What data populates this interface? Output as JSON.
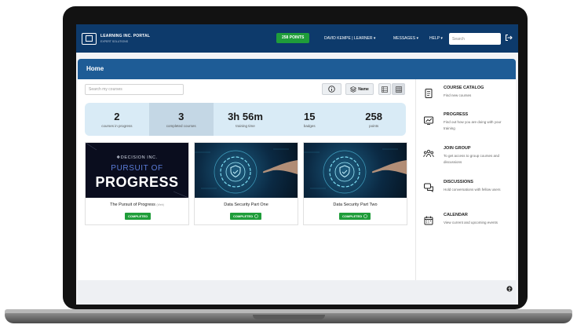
{
  "header": {
    "logo_title": "LEARNING INC. PORTAL",
    "logo_subtitle": "EXPERT SOLUTIONS",
    "points_badge": "258 POINTS",
    "user_menu": "DAVID KEMPE | LEARNER ▾",
    "messages_menu": "MESSAGES ▾",
    "help_menu": "HELP ▾",
    "search_placeholder": "Search"
  },
  "page": {
    "title": "Home"
  },
  "toolbar": {
    "course_search_placeholder": "Search my courses",
    "sort_label": "Name"
  },
  "stats": [
    {
      "value": "2",
      "label": "courses in progress"
    },
    {
      "value": "3",
      "label": "completed courses"
    },
    {
      "value": "3h 56m",
      "label": "training time"
    },
    {
      "value": "15",
      "label": "badges"
    },
    {
      "value": "258",
      "label": "points"
    }
  ],
  "courses": [
    {
      "title": "The Pursuit of Progress",
      "subtitle": "(Web)",
      "status": "COMPLETED",
      "thumb_brand": "❖DECISION INC.",
      "thumb_line1": "PURSUIT OF",
      "thumb_line2": "PROGRESS"
    },
    {
      "title": "Data Security Part One",
      "status": "COMPLETED"
    },
    {
      "title": "Data Security Part Two",
      "status": "COMPLETED"
    }
  ],
  "sidebar": {
    "items": [
      {
        "title": "COURSE CATALOG",
        "description": "Find new courses",
        "icon": "catalog-icon"
      },
      {
        "title": "PROGRESS",
        "description": "Find out how you are doing with your training",
        "icon": "progress-icon"
      },
      {
        "title": "JOIN GROUP",
        "description": "To get access to group courses and discussions",
        "icon": "group-icon"
      },
      {
        "title": "DISCUSSIONS",
        "description": "Hold conversations with fellow users",
        "icon": "discussions-icon"
      },
      {
        "title": "CALENDAR",
        "description": "View current and upcoming events",
        "icon": "calendar-icon"
      }
    ]
  },
  "colors": {
    "nav_bg": "#0d3a6b",
    "home_bar": "#1e5c96",
    "points_green": "#1f9d3a",
    "stats_bg": "#d9ebf6"
  }
}
